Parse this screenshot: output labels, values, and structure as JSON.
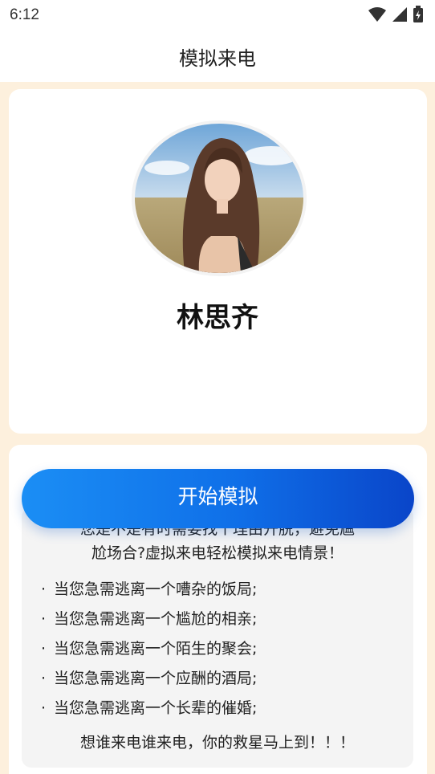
{
  "status_bar": {
    "time": "6:12",
    "icons": [
      "wifi-icon",
      "signal-icon",
      "battery-charging-icon"
    ]
  },
  "header": {
    "title": "模拟来电"
  },
  "caller": {
    "name": "林思齐",
    "avatar": "portrait-photo"
  },
  "action": {
    "start_label": "开始模拟"
  },
  "description": {
    "intro_line_1": "您是不是有时需要找个理由开脱，避免尴",
    "intro_line_2": "尬场合?虚拟来电轻松模拟来电情景！",
    "items": [
      "当您急需逃离一个嘈杂的饭局;",
      "当您急需逃离一个尴尬的相亲;",
      "当您急需逃离一个陌生的聚会;",
      "当您急需逃离一个应酬的酒局;",
      "当您急需逃离一个长辈的催婚;"
    ],
    "bullet": "·",
    "footer": "想谁来电谁来电，你的救星马上到！！！"
  },
  "colors": {
    "page_background": "#fdf0dd",
    "button_gradient_start": "#1b8ef5",
    "button_gradient_end": "#0a45c9"
  }
}
